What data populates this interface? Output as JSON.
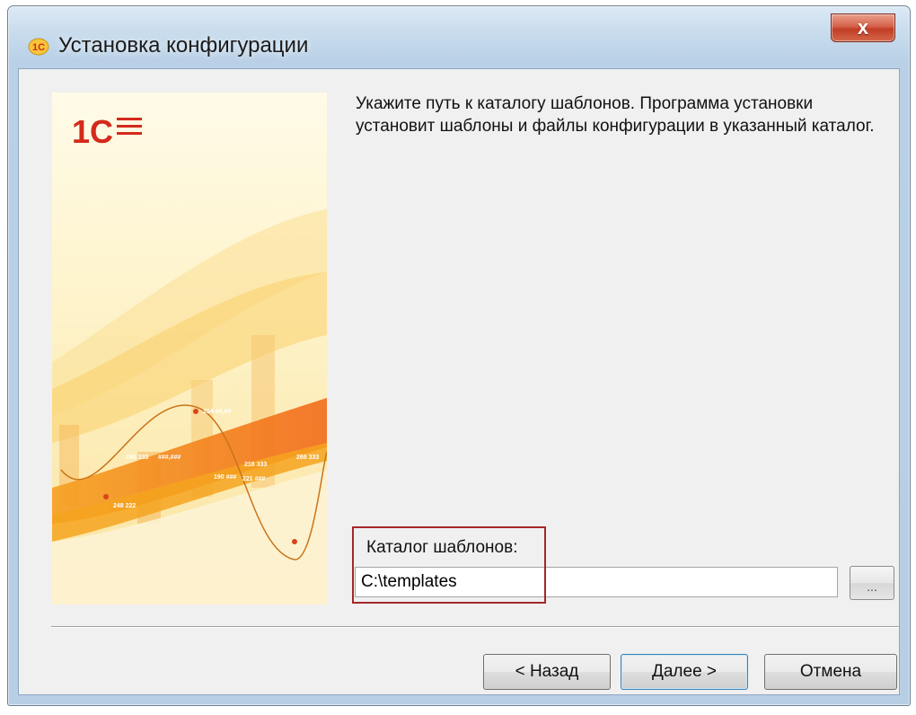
{
  "window": {
    "title": "Установка конфигурации",
    "close_glyph": "x"
  },
  "banner": {
    "logo_text": "1С",
    "chart_labels": [
      "214 ##,##",
      "248 222",
      "186 333",
      "218 333",
      "###,###",
      "190 ###",
      "221 ###",
      "268 333"
    ]
  },
  "instructions": "Укажите путь к каталогу шаблонов. Программа установки установит шаблоны и файлы конфигурации в указанный каталог.",
  "catalog": {
    "label": "Каталог шаблонов:",
    "value": "C:\\templates",
    "browse_label": "..."
  },
  "buttons": {
    "back": "< Назад",
    "next": "Далее >",
    "cancel": "Отмена"
  },
  "colors": {
    "highlight_border": "#a5272a",
    "banner_orange": "#f08a24",
    "logo_red": "#d32a1b"
  }
}
